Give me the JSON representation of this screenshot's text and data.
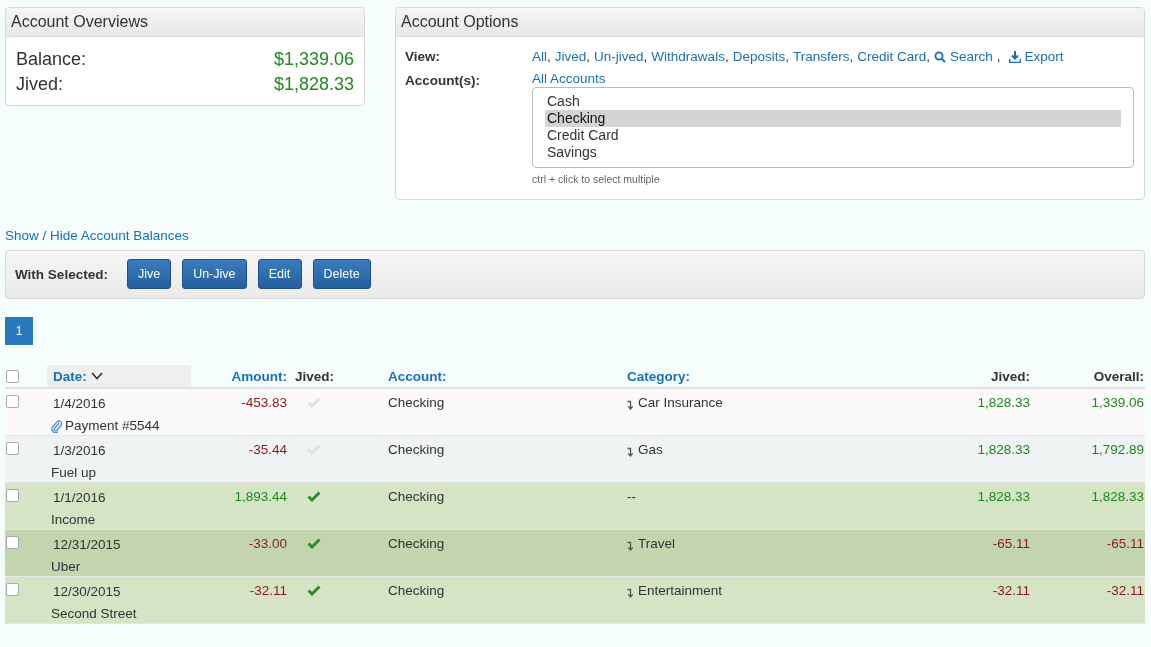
{
  "overview": {
    "title": "Account Overviews",
    "rows": [
      {
        "label": "Balance:",
        "value": "$1,339.06"
      },
      {
        "label": "Jived:",
        "value": "$1,828.33"
      }
    ]
  },
  "options": {
    "title": "Account Options",
    "view_label": "View:",
    "view_links": [
      {
        "text": "All",
        "kind": "plain",
        "separator": ","
      },
      {
        "text": "Jived",
        "kind": "plain",
        "separator": ","
      },
      {
        "text": "Un-jived",
        "kind": "plain",
        "separator": ","
      },
      {
        "text": "Withdrawals",
        "kind": "plain",
        "separator": ","
      },
      {
        "text": "Deposits",
        "kind": "plain",
        "separator": ","
      },
      {
        "text": "Transfers",
        "kind": "plain",
        "separator": ","
      },
      {
        "text": "Credit Card",
        "kind": "plain",
        "separator": ","
      },
      {
        "text": "Search",
        "kind": "search",
        "separator": ","
      },
      {
        "text": "Export",
        "kind": "export"
      }
    ],
    "accounts_label": "Account(s):",
    "all_accounts": "All Accounts",
    "accounts": [
      {
        "name": "Cash",
        "selected": false
      },
      {
        "name": "Checking",
        "selected": true
      },
      {
        "name": "Credit Card",
        "selected": false
      },
      {
        "name": "Savings",
        "selected": false
      }
    ],
    "hint": "ctrl + click to select multiple"
  },
  "toggle_link": "Show / Hide Account Balances",
  "bulk": {
    "label": "With Selected:",
    "buttons": [
      "Jive",
      "Un-Jive",
      "Edit",
      "Delete"
    ]
  },
  "pages": [
    {
      "label": "1",
      "selected": true
    }
  ],
  "table": {
    "select_all_checked": false,
    "columns": [
      {
        "label": "Date:",
        "sortable": true,
        "sorted": true
      },
      {
        "label": "Amount:",
        "sortable": true,
        "sorted": false
      },
      {
        "label": "Jived:",
        "sortable": false,
        "sorted": false
      },
      {
        "label": "Account:",
        "sortable": true,
        "sorted": false
      },
      {
        "label": "Category:",
        "sortable": true,
        "sorted": false
      },
      {
        "label": "Jived:",
        "sortable": false,
        "sorted": false
      },
      {
        "label": "Overall:",
        "sortable": false,
        "sorted": false
      }
    ],
    "rows": [
      {
        "checked": false,
        "date": "1/4/2016",
        "memo": "Payment #5544",
        "attachment": true,
        "amount": {
          "text": "-453.83",
          "positive": false
        },
        "jived": false,
        "highlighted": false,
        "account": "Checking",
        "category": "Car Insurance",
        "split_arrow": true,
        "jived_total": {
          "text": "1,828.33",
          "positive": true
        },
        "overall": {
          "text": "1,339.06",
          "positive": true
        }
      },
      {
        "checked": false,
        "date": "1/3/2016",
        "memo": "Fuel up",
        "attachment": false,
        "amount": {
          "text": "-35.44",
          "positive": false
        },
        "jived": false,
        "highlighted": false,
        "account": "Checking",
        "category": "Gas",
        "split_arrow": true,
        "jived_total": {
          "text": "1,828.33",
          "positive": true
        },
        "overall": {
          "text": "1,792.89",
          "positive": true
        }
      },
      {
        "checked": false,
        "date": "1/1/2016",
        "memo": "Income",
        "attachment": false,
        "amount": {
          "text": "1,893.44",
          "positive": true
        },
        "jived": true,
        "highlighted": false,
        "account": "Checking",
        "category": "--",
        "split_arrow": false,
        "jived_total": {
          "text": "1,828.33",
          "positive": true
        },
        "overall": {
          "text": "1,828.33",
          "positive": true
        }
      },
      {
        "checked": false,
        "date": "12/31/2015",
        "memo": "Uber",
        "attachment": false,
        "amount": {
          "text": "-33.00",
          "positive": false
        },
        "jived": true,
        "highlighted": true,
        "account": "Checking",
        "category": "Travel",
        "split_arrow": true,
        "jived_total": {
          "text": "-65.11",
          "positive": false
        },
        "overall": {
          "text": "-65.11",
          "positive": false
        }
      },
      {
        "checked": false,
        "date": "12/30/2015",
        "memo": "Second Street",
        "attachment": false,
        "amount": {
          "text": "-32.11",
          "positive": false
        },
        "jived": true,
        "highlighted": false,
        "account": "Checking",
        "category": "Entertainment",
        "split_arrow": true,
        "jived_total": {
          "text": "-32.11",
          "positive": false
        },
        "overall": {
          "text": "-32.11",
          "positive": false
        }
      }
    ]
  }
}
